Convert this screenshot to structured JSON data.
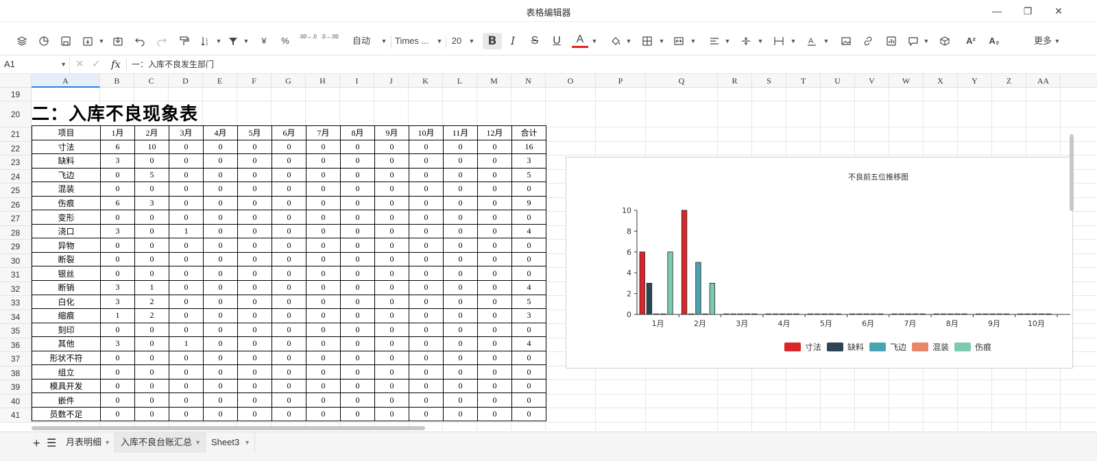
{
  "app": {
    "title": "表格编辑器"
  },
  "window": {
    "minimize": "—",
    "restore": "❐",
    "close": "✕"
  },
  "toolbar": {
    "number_format": "自动",
    "font_name": "Times ...",
    "font_size": "20",
    "currency_label": "¥",
    "percent_label": "%",
    "dec_decrease_label": ".00→.0",
    "dec_increase_label": ".0→.00",
    "bold_label": "B",
    "italic_label": "I",
    "strike_label": "S",
    "underline_label": "U",
    "font_color_label": "A",
    "superscript_label": "A²",
    "subscript_label": "A₂",
    "more_label": "更多"
  },
  "formula_bar": {
    "cell_ref": "A1",
    "fx_label": "fx",
    "content": "一：入库不良发生部门"
  },
  "columns": [
    "A",
    "B",
    "C",
    "D",
    "E",
    "F",
    "G",
    "H",
    "I",
    "J",
    "K",
    "L",
    "M",
    "N",
    "O",
    "P",
    "Q",
    "R",
    "S",
    "T",
    "U",
    "V",
    "W",
    "X",
    "Y",
    "Z",
    "AA"
  ],
  "rows": [
    "19",
    "20",
    "21",
    "22",
    "23",
    "24",
    "25",
    "26",
    "27",
    "28",
    "29",
    "30",
    "31",
    "32",
    "33",
    "34",
    "35",
    "36",
    "37",
    "38",
    "39",
    "40",
    "41"
  ],
  "sheet_title": "二：入库不良现象表",
  "table": {
    "headers": [
      "项目",
      "1月",
      "2月",
      "3月",
      "4月",
      "5月",
      "6月",
      "7月",
      "8月",
      "9月",
      "10月",
      "11月",
      "12月",
      "合计"
    ],
    "rows": [
      [
        "寸法",
        "6",
        "10",
        "0",
        "0",
        "0",
        "0",
        "0",
        "0",
        "0",
        "0",
        "0",
        "0",
        "16"
      ],
      [
        "缺料",
        "3",
        "0",
        "0",
        "0",
        "0",
        "0",
        "0",
        "0",
        "0",
        "0",
        "0",
        "0",
        "3"
      ],
      [
        "飞边",
        "0",
        "5",
        "0",
        "0",
        "0",
        "0",
        "0",
        "0",
        "0",
        "0",
        "0",
        "0",
        "5"
      ],
      [
        "混装",
        "0",
        "0",
        "0",
        "0",
        "0",
        "0",
        "0",
        "0",
        "0",
        "0",
        "0",
        "0",
        "0"
      ],
      [
        "伤痕",
        "6",
        "3",
        "0",
        "0",
        "0",
        "0",
        "0",
        "0",
        "0",
        "0",
        "0",
        "0",
        "9"
      ],
      [
        "变形",
        "0",
        "0",
        "0",
        "0",
        "0",
        "0",
        "0",
        "0",
        "0",
        "0",
        "0",
        "0",
        "0"
      ],
      [
        "浇口",
        "3",
        "0",
        "1",
        "0",
        "0",
        "0",
        "0",
        "0",
        "0",
        "0",
        "0",
        "0",
        "4"
      ],
      [
        "异物",
        "0",
        "0",
        "0",
        "0",
        "0",
        "0",
        "0",
        "0",
        "0",
        "0",
        "0",
        "0",
        "0"
      ],
      [
        "断裂",
        "0",
        "0",
        "0",
        "0",
        "0",
        "0",
        "0",
        "0",
        "0",
        "0",
        "0",
        "0",
        "0"
      ],
      [
        "银丝",
        "0",
        "0",
        "0",
        "0",
        "0",
        "0",
        "0",
        "0",
        "0",
        "0",
        "0",
        "0",
        "0"
      ],
      [
        "断销",
        "3",
        "1",
        "0",
        "0",
        "0",
        "0",
        "0",
        "0",
        "0",
        "0",
        "0",
        "0",
        "4"
      ],
      [
        "白化",
        "3",
        "2",
        "0",
        "0",
        "0",
        "0",
        "0",
        "0",
        "0",
        "0",
        "0",
        "0",
        "5"
      ],
      [
        "缩痕",
        "1",
        "2",
        "0",
        "0",
        "0",
        "0",
        "0",
        "0",
        "0",
        "0",
        "0",
        "0",
        "3"
      ],
      [
        "刻印",
        "0",
        "0",
        "0",
        "0",
        "0",
        "0",
        "0",
        "0",
        "0",
        "0",
        "0",
        "0",
        "0"
      ],
      [
        "其他",
        "3",
        "0",
        "1",
        "0",
        "0",
        "0",
        "0",
        "0",
        "0",
        "0",
        "0",
        "0",
        "4"
      ],
      [
        "形状不符",
        "0",
        "0",
        "0",
        "0",
        "0",
        "0",
        "0",
        "0",
        "0",
        "0",
        "0",
        "0",
        "0"
      ],
      [
        "组立",
        "0",
        "0",
        "0",
        "0",
        "0",
        "0",
        "0",
        "0",
        "0",
        "0",
        "0",
        "0",
        "0"
      ],
      [
        "模具开发",
        "0",
        "0",
        "0",
        "0",
        "0",
        "0",
        "0",
        "0",
        "0",
        "0",
        "0",
        "0",
        "0"
      ],
      [
        "嵌件",
        "0",
        "0",
        "0",
        "0",
        "0",
        "0",
        "0",
        "0",
        "0",
        "0",
        "0",
        "0",
        "0"
      ],
      [
        "员数不足",
        "0",
        "0",
        "0",
        "0",
        "0",
        "0",
        "0",
        "0",
        "0",
        "0",
        "0",
        "0",
        "0"
      ]
    ]
  },
  "chart_data": {
    "type": "bar",
    "title": "不良前五位推移图",
    "categories": [
      "1月",
      "2月",
      "3月",
      "4月",
      "5月",
      "6月",
      "7月",
      "8月",
      "9月",
      "10月"
    ],
    "ylim": [
      0,
      10
    ],
    "yticks": [
      "0",
      "2",
      "4",
      "6",
      "8",
      "10"
    ],
    "grid": false,
    "legend_position": "bottom",
    "series": [
      {
        "name": "寸法",
        "color": "#d9262a",
        "values": [
          6,
          10,
          0,
          0,
          0,
          0,
          0,
          0,
          0,
          0
        ]
      },
      {
        "name": "缺料",
        "color": "#2c4653",
        "values": [
          3,
          0,
          0,
          0,
          0,
          0,
          0,
          0,
          0,
          0
        ]
      },
      {
        "name": "飞边",
        "color": "#4aa3b0",
        "values": [
          0,
          5,
          0,
          0,
          0,
          0,
          0,
          0,
          0,
          0
        ]
      },
      {
        "name": "混装",
        "color": "#e8866a",
        "values": [
          0,
          0,
          0,
          0,
          0,
          0,
          0,
          0,
          0,
          0
        ]
      },
      {
        "name": "伤痕",
        "color": "#7ecab0",
        "values": [
          6,
          3,
          0,
          0,
          0,
          0,
          0,
          0,
          0,
          0
        ]
      }
    ]
  },
  "sheet_tabs": [
    {
      "label": "月表明细",
      "active": false
    },
    {
      "label": "入库不良台账汇总",
      "active": true
    },
    {
      "label": "Sheet3",
      "active": false
    }
  ],
  "tabs_controls": {
    "add": "+",
    "list": "☰"
  }
}
